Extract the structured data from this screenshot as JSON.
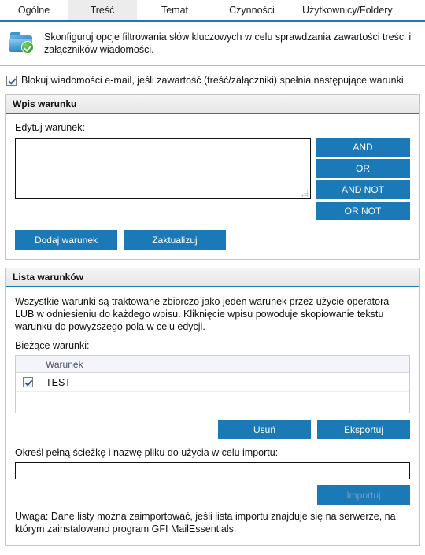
{
  "colors": {
    "accent_blue": "#1b79b8",
    "tab_active_bg": "#ececec",
    "panel_header_bg": "#eeeeee",
    "disabled_text": "#6e9ebe"
  },
  "tabs": [
    {
      "label": "Ogólne",
      "active": false
    },
    {
      "label": "Treść",
      "active": true
    },
    {
      "label": "Temat",
      "active": false
    },
    {
      "label": "Czynności",
      "active": false
    },
    {
      "label": "Użytkownicy/Foldery",
      "active": false
    }
  ],
  "intro": {
    "icon": "folder-check-icon",
    "text": "Skonfiguruj opcje filtrowania słów kluczowych w celu sprawdzania zawartości treści i załączników wiadomości."
  },
  "master_checkbox": {
    "checked": true,
    "label": "Blokuj wiadomości e-mail, jeśli zawartość (treść/załączniki) spełnia następujące warunki"
  },
  "entry_panel": {
    "title": "Wpis warunku",
    "editor_label": "Edytuj warunek:",
    "editor_value": "",
    "editor_placeholder": "",
    "operators": [
      {
        "label": "AND"
      },
      {
        "label": "OR"
      },
      {
        "label": "AND NOT"
      },
      {
        "label": "OR NOT"
      }
    ],
    "add_label": "Dodaj warunek",
    "update_label": "Zaktualizuj"
  },
  "list_panel": {
    "title": "Lista warunków",
    "description": "Wszystkie warunki są traktowane zbiorczo jako jeden warunek przez użycie operatora LUB w odniesieniu do każdego wpisu. Kliknięcie wpisu powoduje skopiowanie tekstu warunku do powyższego pola w celu edycji.",
    "current_label": "Bieżące warunki:",
    "table": {
      "columns": [
        "",
        "Warunek"
      ],
      "rows": [
        {
          "checked": true,
          "condition": "TEST"
        }
      ]
    },
    "delete_label": "Usuń",
    "export_label": "Eksportuj",
    "import_path_label": "Określ pełną ścieżkę i nazwę pliku do użycia w celu importu:",
    "import_path_value": "",
    "import_path_placeholder": "",
    "import_label": "Importuj",
    "import_enabled": false,
    "note": "Uwaga: Dane listy można zaimportować, jeśli lista importu znajduje się na serwerze, na którym zainstalowano program GFI MailEssentials."
  }
}
